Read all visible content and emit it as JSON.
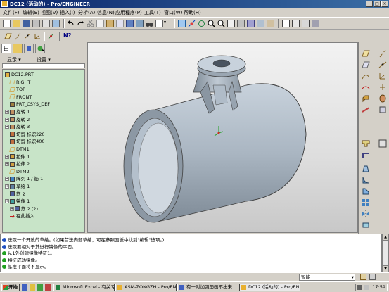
{
  "window": {
    "title": "DC12 (活动的) - Pro/ENGINEER"
  },
  "menu": [
    "文件(F)",
    "编辑(E)",
    "视图(V)",
    "插入(I)",
    "分析(A)",
    "信息(N)",
    "应用程序(P)",
    "工具(T)",
    "窗口(W)",
    "帮助(H)"
  ],
  "left_panel": {
    "show_label": "显示",
    "settings_label": "设置",
    "tree": [
      {
        "label": "DC12.PRT",
        "icon": "part-icon",
        "expander": false,
        "indent": 0
      },
      {
        "label": "RIGHT",
        "icon": "datum-plane-icon",
        "expander": false,
        "indent": 1
      },
      {
        "label": "TOP",
        "icon": "datum-plane-icon",
        "expander": false,
        "indent": 1
      },
      {
        "label": "FRONT",
        "icon": "datum-plane-icon",
        "expander": false,
        "indent": 1
      },
      {
        "label": "PRT_CSYS_DEF",
        "icon": "csys-icon",
        "expander": false,
        "indent": 1
      },
      {
        "label": "旋转 1",
        "icon": "revolve-icon",
        "expander": true,
        "indent": 0
      },
      {
        "label": "旋转 2",
        "icon": "revolve-icon",
        "expander": true,
        "indent": 0
      },
      {
        "label": "旋转 3",
        "icon": "revolve-icon",
        "expander": true,
        "indent": 0
      },
      {
        "label": "切剪 标识220",
        "icon": "cut-icon",
        "expander": false,
        "indent": 1
      },
      {
        "label": "切剪 标识400",
        "icon": "cut-icon",
        "expander": false,
        "indent": 1
      },
      {
        "label": "DTM1",
        "icon": "datum-plane-icon",
        "expander": false,
        "indent": 1
      },
      {
        "label": "拉伸 1",
        "icon": "extrude-icon",
        "expander": true,
        "indent": 0
      },
      {
        "label": "拉伸 2",
        "icon": "extrude-icon",
        "expander": true,
        "indent": 0
      },
      {
        "label": "DTM2",
        "icon": "datum-plane-icon",
        "expander": false,
        "indent": 1
      },
      {
        "label": "阵列 1 / 筋 1",
        "icon": "pattern-icon",
        "expander": true,
        "indent": 0
      },
      {
        "label": "草绘 1",
        "icon": "sketch-icon",
        "expander": true,
        "indent": 0
      },
      {
        "label": "筋 2",
        "icon": "rib-icon",
        "expander": false,
        "indent": 1
      },
      {
        "label": "镜像 1",
        "icon": "mirror-icon",
        "expander": true,
        "indent": 0
      },
      {
        "label": "筋 2 (2)",
        "icon": "rib-icon",
        "expander": true,
        "indent": 1
      },
      {
        "label": "在此插入",
        "icon": "insert-here-icon",
        "expander": false,
        "indent": 1
      }
    ]
  },
  "messages": [
    {
      "icon": "info",
      "text": "选取一个开放的草绘。(如果首选内部草绘，可在参照面板中找到\"编辑\"选项。)"
    },
    {
      "icon": "info",
      "text": "选取要相对于其进行镜像的平面。"
    },
    {
      "icon": "check",
      "text": "从1外创建镜像特征1。"
    },
    {
      "icon": "check",
      "text": "特征成功镜像。"
    },
    {
      "icon": "check",
      "text": "基准平面将不显示。"
    }
  ],
  "status": {
    "filter_value": "智能"
  },
  "taskbar": {
    "start_label": "开始",
    "tasks": [
      "Microsoft Excel - 有关专...",
      "ASM-ZONGZH - Pro/ENGI...",
      "有一对加强筋画不出来...",
      "DC12 (活动的) - Pro/EN..."
    ],
    "clock": "17:59"
  },
  "colors": {
    "title_bar": "#0a246a",
    "tree_background": "#c8e4c8",
    "model_color": "#a8b4be"
  }
}
